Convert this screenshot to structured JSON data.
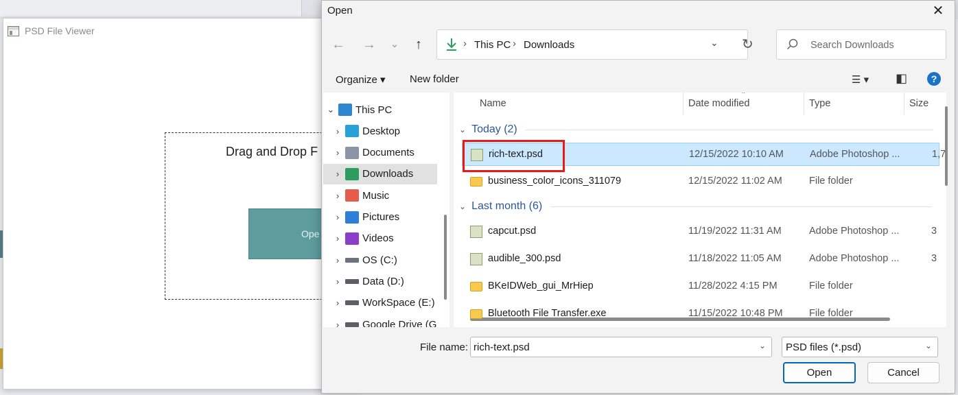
{
  "viewer": {
    "title": "PSD File Viewer",
    "drop_text": "Drag and Drop F",
    "open_button": "Ope"
  },
  "dialog": {
    "title": "Open",
    "close_glyph": "✕",
    "nav": {
      "back": "←",
      "forward": "→",
      "recent": "⌄",
      "up": "↑"
    },
    "address": {
      "segments": [
        "This PC",
        "Downloads"
      ],
      "separator": "›",
      "dropdown": "⌄",
      "refresh": "↻"
    },
    "search_placeholder": "Search Downloads",
    "toolbar": {
      "organize": "Organize ▾",
      "new_folder": "New folder",
      "view_glyph": "☰ ▾",
      "pane_glyph": "◧",
      "help_glyph": "?"
    },
    "tree": [
      {
        "label": "This PC",
        "expander": "⌄",
        "icon": "pc-icon",
        "color": "#2d86d1"
      },
      {
        "label": "Desktop",
        "expander": "›",
        "icon": "desktop-icon",
        "color": "#2aa0d8"
      },
      {
        "label": "Documents",
        "expander": "›",
        "icon": "documents-icon",
        "color": "#8a94a6"
      },
      {
        "label": "Downloads",
        "expander": "›",
        "icon": "downloads-icon",
        "color": "#2e9b5f"
      },
      {
        "label": "Music",
        "expander": "›",
        "icon": "music-icon",
        "color": "#e35d4a"
      },
      {
        "label": "Pictures",
        "expander": "›",
        "icon": "pictures-icon",
        "color": "#2f7fd6"
      },
      {
        "label": "Videos",
        "expander": "›",
        "icon": "videos-icon",
        "color": "#8b3fc8"
      },
      {
        "label": "OS (C:)",
        "expander": "›",
        "icon": "drive-c-icon",
        "color": "#6c7380"
      },
      {
        "label": "Data (D:)",
        "expander": "›",
        "icon": "drive-d-icon",
        "color": "#5a5f68"
      },
      {
        "label": "WorkSpace (E:)",
        "expander": "›",
        "icon": "drive-e-icon",
        "color": "#5a5f68"
      },
      {
        "label": "Google Drive (G",
        "expander": "›",
        "icon": "drive-g-icon",
        "color": "#5a5f68"
      }
    ],
    "columns": {
      "name": "Name",
      "date": "Date modified",
      "type": "Type",
      "size": "Size",
      "sort_caret": "⌃"
    },
    "groups": {
      "today": "Today (2)",
      "last_month": "Last month (6)",
      "collapse_glyph": "⌄"
    },
    "today_files": [
      {
        "name": "rich-text.psd",
        "date": "12/15/2022 10:10 AM",
        "type": "Adobe Photoshop ...",
        "size": "1,7",
        "kind": "psd"
      },
      {
        "name": "business_color_icons_311079",
        "date": "12/15/2022 11:02 AM",
        "type": "File folder",
        "size": "",
        "kind": "folder"
      }
    ],
    "last_month_files": [
      {
        "name": "capcut.psd",
        "date": "11/19/2022 11:31 AM",
        "type": "Adobe Photoshop ...",
        "size": "3",
        "kind": "psd"
      },
      {
        "name": "audible_300.psd",
        "date": "11/18/2022 11:05 AM",
        "type": "Adobe Photoshop ...",
        "size": "3",
        "kind": "psd"
      },
      {
        "name": "BKeIDWeb_gui_MrHiep",
        "date": "11/28/2022 4:15 PM",
        "type": "File folder",
        "size": "",
        "kind": "folder"
      },
      {
        "name": "Bluetooth File Transfer.exe",
        "date": "11/15/2022 10:48 PM",
        "type": "File folder",
        "size": "",
        "kind": "folder"
      }
    ],
    "file_name_label": "File name:",
    "file_name_value": "rich-text.psd",
    "file_type": "PSD files (*.psd)",
    "dropdown_glyph": "⌄",
    "open_label": "Open",
    "cancel_label": "Cancel",
    "colors": {
      "accent": "#0067c0",
      "selection": "#cce8ff",
      "highlight_box": "#e81919",
      "group_header": "#2b579a"
    }
  }
}
